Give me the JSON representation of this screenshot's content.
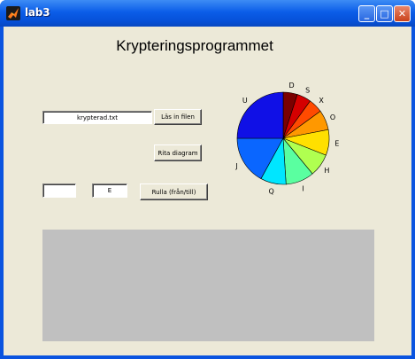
{
  "window": {
    "title": "lab3",
    "minimize_glyph": "_",
    "maximize_glyph": "□",
    "close_glyph": "✕",
    "app_icon": "matlab-logo-icon"
  },
  "heading": "Krypteringsprogrammet",
  "file_input": {
    "value": "krypterad.txt"
  },
  "buttons": {
    "load_file": "Läs in filen",
    "draw_chart": "Rita diagram",
    "shift": "Rulla (från/till)"
  },
  "from_input": {
    "value": ""
  },
  "to_input": {
    "value": "E"
  },
  "chart_data": {
    "type": "pie",
    "labels": [
      "D",
      "S",
      "X",
      "O",
      "E",
      "H",
      "I",
      "Q",
      "J",
      "U"
    ],
    "values": [
      0.05,
      0.05,
      0.05,
      0.07,
      0.09,
      0.08,
      0.1,
      0.09,
      0.17,
      0.25
    ],
    "colors": [
      "#7a0000",
      "#d40000",
      "#ff4a00",
      "#ff9800",
      "#ffe000",
      "#b0ff50",
      "#5affa0",
      "#00e6ff",
      "#0a66ff",
      "#1010e6",
      "#000090"
    ]
  },
  "output_panel": {
    "text": ""
  }
}
